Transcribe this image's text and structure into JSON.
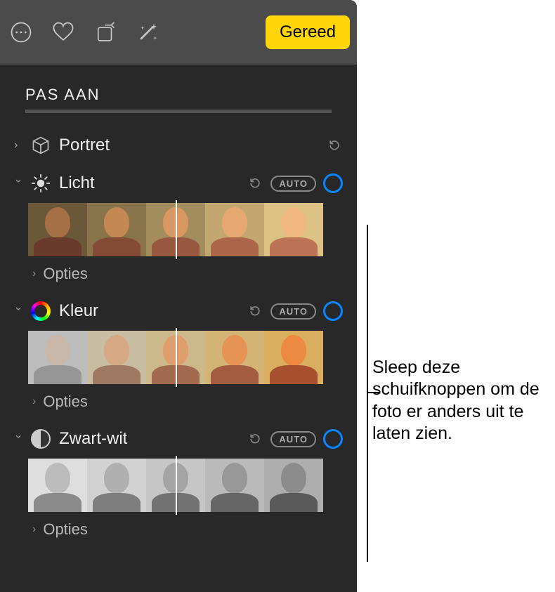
{
  "toolbar": {
    "done_label": "Gereed"
  },
  "main": {
    "title": "PAS AAN"
  },
  "sections": {
    "portrait": {
      "label": "Portret"
    },
    "light": {
      "label": "Licht",
      "auto": "AUTO",
      "options": "Opties"
    },
    "color": {
      "label": "Kleur",
      "auto": "AUTO",
      "options": "Opties"
    },
    "bw": {
      "label": "Zwart-wit",
      "auto": "AUTO",
      "options": "Opties"
    }
  },
  "callout": {
    "text": "Sleep deze schuifknoppen om de foto er anders uit te laten zien."
  }
}
